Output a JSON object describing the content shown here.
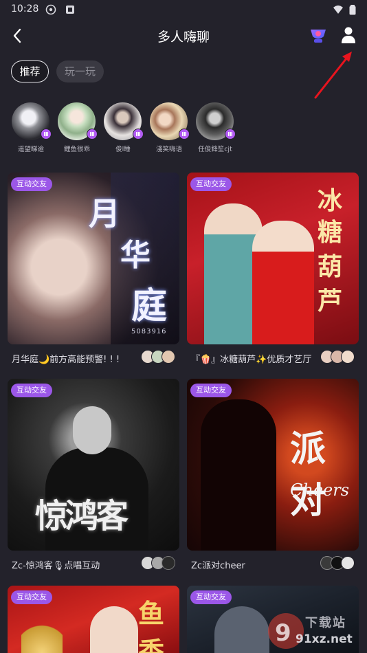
{
  "status_bar": {
    "time": "10:28"
  },
  "header": {
    "title": "多人嗨聊"
  },
  "tabs": [
    {
      "label": "推荐",
      "active": true
    },
    {
      "label": "玩一玩",
      "active": false
    }
  ],
  "stories": [
    {
      "name": "遥望睇逾"
    },
    {
      "name": "鲤鱼很乖"
    },
    {
      "name": "俊l睡"
    },
    {
      "name": "淺笑嗨语"
    },
    {
      "name": "任俊鋒笙cjt"
    }
  ],
  "rooms": [
    {
      "tag": "互动交友",
      "title": "月华庭🌙前方高能预警! ! !",
      "cover_text": "月华庭",
      "cover_sub": "5083916"
    },
    {
      "tag": "互动交友",
      "title": "『🍿』冰糖葫芦✨优质才艺厅",
      "cover_text": "冰糖葫芦"
    },
    {
      "tag": "互动交友",
      "title": "Zc-惊鸿客🎙点唱互动",
      "cover_text": "惊鸿客"
    },
    {
      "tag": "互动交友",
      "title": "Zc派对cheer",
      "cover_text": "派对",
      "cover_sub": "Cheers"
    },
    {
      "tag": "互动交友",
      "title": "",
      "cover_text": "鱼香"
    },
    {
      "tag": "互动交友",
      "title": ""
    }
  ],
  "watermark": {
    "text": "91xz.net",
    "logo_text": "下载站"
  },
  "colors": {
    "background": "#23222b",
    "accent": "#9b57e8",
    "arrow": "#e8141e"
  }
}
